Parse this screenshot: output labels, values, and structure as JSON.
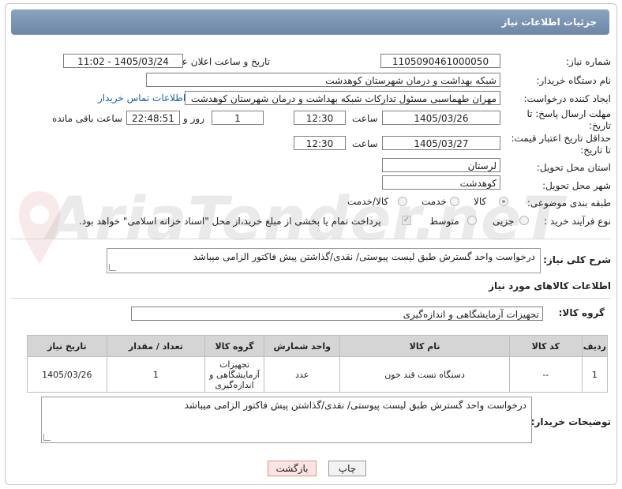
{
  "header": {
    "title": "جزئیات اطلاعات نیاز"
  },
  "watermark": {
    "text": "AriaTender.neT"
  },
  "need_number": {
    "label": "شماره نیاز:",
    "value": "1105090461000050"
  },
  "announce": {
    "label": "تاریخ و ساعت اعلان عمومی:",
    "value": "1405/03/24 - 11:02"
  },
  "buyer_org": {
    "label": "نام دستگاه خریدار:",
    "value": "شبکه بهداشت و درمان شهرستان کوهدشت"
  },
  "requester": {
    "label": "ایجاد کننده درخواست:",
    "value": "مهران طهماسبی مسئول تدارکات شبکه بهداشت و درمان شهرستان کوهدشت",
    "contact_link": "اطلاعات تماس خریدار"
  },
  "deadline": {
    "label_line1": "مهلت ارسال پاسخ: تا",
    "label_line2": "تاریخ:",
    "date": "1405/03/26",
    "time_label": "ساعت",
    "time": "12:30",
    "days": "1",
    "days_label": "روز و",
    "remaining": "22:48:51",
    "remaining_label": "ساعت باقی مانده"
  },
  "price_validity": {
    "label_line1": "حداقل تاریخ اعتبار قیمت:",
    "label_line2": "تا تاریخ:",
    "date": "1405/03/27",
    "time_label": "ساعت",
    "time": "12:30"
  },
  "province": {
    "label": "استان محل تحویل:",
    "value": "لرستان"
  },
  "city": {
    "label": "شهر محل تحویل:",
    "value": "کوهدشت"
  },
  "category": {
    "label": "طبقه بندی موضوعی:",
    "options": [
      "کالا",
      "خدمت",
      "کالا/خدمت"
    ],
    "selected": "کالا"
  },
  "process": {
    "label": "نوع فرآیند خرید :",
    "options": [
      "جزیی",
      "متوسط"
    ],
    "payment_note": "پرداخت تمام یا بخشی از مبلغ خرید،از محل \"اسناد خزانه اسلامی\" خواهد بود."
  },
  "summary": {
    "label": "شرح کلی نیاز:",
    "value": "درخواست واحد گسترش طبق لیست پیوستی/ نقدی/گذاشتن پیش فاکتور الزامی میباشد"
  },
  "goods_info": {
    "title": "اطلاعات کالاهای مورد نیاز"
  },
  "goods_group": {
    "label": "گروه کالا:",
    "value": "تجهیزات آزمایشگاهی و اندازه‌گیری"
  },
  "table": {
    "headers": [
      "ردیف",
      "کد کالا",
      "نام کالا",
      "واحد شمارش",
      "گروه کالا",
      "تعداد / مقدار",
      "تاریخ نیاز"
    ],
    "rows": [
      {
        "row": "1",
        "code": "--",
        "name": "دستگاه تست قند خون",
        "unit": "عدد",
        "group_line1": "تجهیزات",
        "group_line2": "آزمایشگاهی و",
        "group_line3": "اندازه‌گیری",
        "qty": "1",
        "date": "1405/03/26"
      }
    ]
  },
  "buyer_notes": {
    "label": "توضیحات خریدار:",
    "value": "درخواست واحد گسترش طبق لیست پیوستی/ نقدی/گذاشتن پیش فاکتور الزامی میباشد"
  },
  "buttons": {
    "print": "چاپ",
    "back": "بازگشت"
  }
}
